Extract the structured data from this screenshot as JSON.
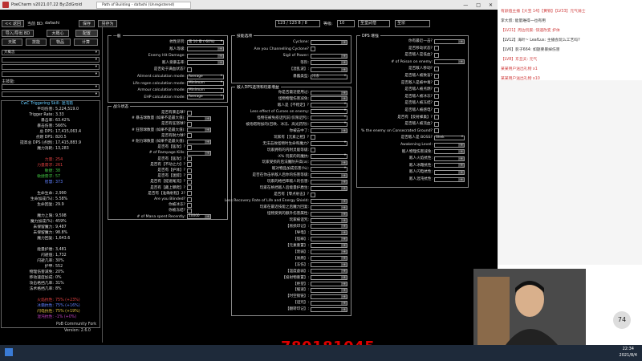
{
  "window": {
    "title": "PoeCharm v2021.07.22 By:ZdGroid",
    "tab": "Path of Building - dafashi (Unregistered)",
    "minimize": "—",
    "maximize": "□",
    "close": "✕"
  },
  "toolbar": {
    "back": "<< 返回",
    "current_bd_label": "当前 BD:",
    "current_bd": "dafashi",
    "save": "保存",
    "save_as": "另存为",
    "points": "123 / 123",
    "points_extra": "8 / 8",
    "level_label": "等级:",
    "level": "10",
    "class": "圣堂武僧",
    "ascendancy": "圣宗",
    "import_export": "导入/导出 BD",
    "notes": "大概心",
    "config": "配置",
    "tab_tree": "天赋",
    "tab_skills": "技能",
    "tab_items": "物品",
    "tab_calcs": "计算"
  },
  "sidebar": {
    "main_skill_label": "主技能:",
    "dropdowns": [
      "大概念",
      "",
      "",
      "",
      "",
      "",
      "",
      "",
      "",
      "",
      ""
    ],
    "stats_header": "CwC Triggering Skill: 混沌箭",
    "stats": [
      {
        "k": "平均伤害:",
        "v": "5,224,519.0",
        "c": "#ddd"
      },
      {
        "k": "Trigger Rate:",
        "v": "3.33",
        "c": "#ddd"
      },
      {
        "k": "暴击率:",
        "v": "63.42%",
        "c": "#ddd"
      },
      {
        "k": "暴击伤害:",
        "v": "566%",
        "c": "#ddd"
      },
      {
        "k": "总 DPS:",
        "v": "17,415,063.4",
        "c": "#ddd"
      },
      {
        "k": "点燃 DPS:",
        "v": "820.5",
        "c": "#ddd"
      },
      {
        "k": "提高总 DPS (点燃):",
        "v": "17,415,883.9",
        "c": "#ddd"
      },
      {
        "k": "魔力消耗:",
        "v": "13,283",
        "c": "#ddd"
      },
      {
        "k": "",
        "v": "",
        "c": "#ddd"
      },
      {
        "k": "力量:",
        "v": "254",
        "c": "#e04040"
      },
      {
        "k": "力量需求:",
        "v": "261",
        "c": "#e04040"
      },
      {
        "k": "敏捷:",
        "v": "38",
        "c": "#40c040"
      },
      {
        "k": "敏捷需求:",
        "v": "57",
        "c": "#40c040"
      },
      {
        "k": "智慧:",
        "v": "373",
        "c": "#6080ff"
      },
      {
        "k": "",
        "v": "",
        "c": "#ddd"
      },
      {
        "k": "生命生命:",
        "v": "2,990",
        "c": "#ddd"
      },
      {
        "k": "生命加成(%):",
        "v": "5.58%",
        "c": "#ddd"
      },
      {
        "k": "生命回复:",
        "v": "29.9",
        "c": "#ddd"
      },
      {
        "k": "",
        "v": "",
        "c": "#ddd"
      },
      {
        "k": "魔力上限:",
        "v": "9,598",
        "c": "#ddd"
      },
      {
        "k": "魔力加成(%):",
        "v": "459%",
        "c": "#ddd"
      },
      {
        "k": "未保留魔力:",
        "v": "9,487",
        "c": "#ddd"
      },
      {
        "k": "未保留魔力:",
        "v": "98.8%",
        "c": "#ddd"
      },
      {
        "k": "魔力回复:",
        "v": "1,643.6",
        "c": "#ddd"
      },
      {
        "k": "",
        "v": "",
        "c": "#ddd"
      },
      {
        "k": "能量护盾:",
        "v": "3,481",
        "c": "#ddd"
      },
      {
        "k": "闪避值:",
        "v": "1,732",
        "c": "#ddd"
      },
      {
        "k": "闪避几率:",
        "v": "30%",
        "c": "#ddd"
      },
      {
        "k": "护甲:",
        "v": "552",
        "c": "#ddd"
      },
      {
        "k": "物理伤害减免:",
        "v": "20%",
        "c": "#ddd"
      },
      {
        "k": "移动速度加成:",
        "v": "0%",
        "c": "#ddd"
      },
      {
        "k": "攻击格挡几率:",
        "v": "31%",
        "c": "#ddd"
      },
      {
        "k": "法术格挡几率:",
        "v": "8%",
        "c": "#ddd"
      },
      {
        "k": "",
        "v": "",
        "c": "#ddd"
      },
      {
        "k": "火焰抗性:",
        "v": "75% (+23%)",
        "c": "#e04040"
      },
      {
        "k": "冰霜抗性:",
        "v": "75% (+16%)",
        "c": "#6080ff"
      },
      {
        "k": "闪电抗性:",
        "v": "75% (+19%)",
        "c": "#e0c040"
      },
      {
        "k": "混沌抗性:",
        "v": "-1% (+0%)",
        "c": "#c040c0"
      }
    ],
    "pob_name": "PoB Community Fork",
    "pob_version": "Version: 2.6.0"
  },
  "general": {
    "title": "一般",
    "rows": [
      {
        "k": "抗性惩罚:",
        "v": "第 10 章 (-60%)"
      },
      {
        "k": "敌人等级:",
        "v": ""
      },
      {
        "k": "Enemy Hit Damage:",
        "v": ""
      },
      {
        "k": "敌人受暴击率:",
        "v": ""
      },
      {
        "k": "是否处于满血状态?",
        "v": ""
      },
      {
        "k": "Ailment calculation mode:",
        "v": "Average"
      },
      {
        "k": "Life regen calculation mode:",
        "v": "Minimum"
      },
      {
        "k": "Armour calculation mode:",
        "v": "Minimum"
      },
      {
        "k": "EHP calculation mode:",
        "v": "Average"
      }
    ]
  },
  "skill_options": {
    "title": "技能选项",
    "rows": [
      {
        "k": "Cyclone:",
        "v": ""
      },
      {
        "k": "Are you Channelling Cyclone?",
        "v": ""
      },
      {
        "k": "Sigil of Power:",
        "v": ""
      },
      {
        "k": "等阶:",
        "v": ""
      },
      {
        "k": "【混乱波】:",
        "v": ""
      },
      {
        "k": "暴露类型:",
        "v": "冷冻"
      }
    ]
  },
  "combat": {
    "title": "战斗状态",
    "rows": [
      {
        "k": "是否有暴击球?",
        "v": ""
      },
      {
        "k": "# 暴击球数量 (如果不是最大值):",
        "v": ""
      },
      {
        "k": "是否有狂怒球?",
        "v": ""
      },
      {
        "k": "# 狂怒球数量 (如果不是最大值):",
        "v": ""
      },
      {
        "k": "是否有耐力球?",
        "v": ""
      },
      {
        "k": "# 耐力球数量 (如果不是最大值):",
        "v": ""
      },
      {
        "k": "是否有【猛攻】?",
        "v": ""
      },
      {
        "k": "# of Rampage Kills:",
        "v": ""
      },
      {
        "k": "是否有【猛攻】?",
        "v": ""
      },
      {
        "k": "是否有【不动之力】?",
        "v": ""
      },
      {
        "k": "是否有【护体】?",
        "v": ""
      },
      {
        "k": "是否有【迷醉】?",
        "v": ""
      },
      {
        "k": "是否有【提速尾流】?",
        "v": ""
      },
      {
        "k": "是否有【藏上攀爬】?",
        "v": ""
      },
      {
        "k": "是否有【准确射程】2?",
        "v": ""
      },
      {
        "k": "Are you Blinded?",
        "v": ""
      },
      {
        "k": "你被冰冻?",
        "v": ""
      },
      {
        "k": "你被冻结?",
        "v": ""
      },
      {
        "k": "# of Mana spent Recently:",
        "v": "10000"
      }
    ]
  },
  "effective_dps": {
    "title": "敌人DPS选项和玩家增益",
    "rows": [
      {
        "k": "你是否最近使用过:",
        "v": ""
      },
      {
        "k": "怪物物理伤害减免:",
        "v": ""
      },
      {
        "k": "敌人是【不稳定】?",
        "v": ""
      },
      {
        "k": "Less effect of Curses on enemy:",
        "v": ""
      },
      {
        "k": "怪物在被免疫诅咒前(仅限诅咒):",
        "v": ""
      },
      {
        "k": "被炮塔附加的(召唤、冰冻、高光药剂):",
        "v": ""
      },
      {
        "k": "你被击中了:",
        "v": ""
      },
      {
        "k": "玩家有【元素之相】?",
        "v": ""
      },
      {
        "k": "无法击败怪物时生命和魔力?",
        "v": ""
      },
      {
        "k": "玩家拥有的内附灵能等级:",
        "v": ""
      },
      {
        "k": "-X% 玩家的的魔抗:",
        "v": ""
      },
      {
        "k": "玩家受损的后法魔防升高(a):",
        "v": ""
      },
      {
        "k": "敌对物品加成伤害(%):",
        "v": ""
      },
      {
        "k": "是否在你击杀敌人后你的伤害等级:",
        "v": ""
      },
      {
        "k": "玩家的格挡率敌人的伤害:",
        "v": ""
      },
      {
        "k": "玩家在格挡敌人后能量护盾生:",
        "v": ""
      },
      {
        "k": "是否有【零点射击】?",
        "v": ""
      },
      {
        "k": "Less Recovery Rate of Life and Energy Shield:",
        "v": ""
      },
      {
        "k": "玩家在最近技能之后魔力回复:",
        "v": ""
      },
      {
        "k": "怪物受到的额外伤害属性:",
        "v": ""
      },
      {
        "k": "玩家被诅咒:",
        "v": ""
      },
      {
        "k": "【易损印记】:",
        "v": ""
      },
      {
        "k": "【导电】:",
        "v": ""
      },
      {
        "k": "【怪罪】:",
        "v": ""
      },
      {
        "k": "【元素重置】:",
        "v": ""
      },
      {
        "k": "【衰弱】:",
        "v": ""
      },
      {
        "k": "【易燃】:",
        "v": ""
      },
      {
        "k": "【冻伤】:",
        "v": ""
      },
      {
        "k": "【温度虚弱】:",
        "v": ""
      },
      {
        "k": "【投射物重置】:",
        "v": ""
      },
      {
        "k": "【绝望】:",
        "v": ""
      },
      {
        "k": "【缓速】:",
        "v": ""
      },
      {
        "k": "【时空锁链】:",
        "v": ""
      },
      {
        "k": "【诅咒】:",
        "v": ""
      },
      {
        "k": "【翻转印记】:",
        "v": ""
      }
    ]
  },
  "dps_options": {
    "title": "DPS 增强",
    "rows": [
      {
        "k": "你有最近一击?",
        "v": ""
      },
      {
        "k": "是否移动状态?",
        "v": ""
      },
      {
        "k": "是否敌人是低血?",
        "v": ""
      },
      {
        "k": "# of Poison on enemy:",
        "v": ""
      },
      {
        "k": "是否敌人移动?",
        "v": ""
      },
      {
        "k": "是否敌人被致盲?",
        "v": ""
      },
      {
        "k": "是否敌人是被中毒?",
        "v": ""
      },
      {
        "k": "是否敌人被点燃?",
        "v": ""
      },
      {
        "k": "是否敌人被冰冻?",
        "v": ""
      },
      {
        "k": "是否敌人被冻结?",
        "v": ""
      },
      {
        "k": "是否敌人被感电?",
        "v": ""
      },
      {
        "k": "是否有【反射蜂巢】?",
        "v": ""
      },
      {
        "k": "是否敌人被流血?",
        "v": ""
      },
      {
        "k": "% the enemy on Consecrated Ground?",
        "v": ""
      },
      {
        "k": "是否敌人是 BOSS?",
        "v": "Shek"
      },
      {
        "k": "Awakening Level:",
        "v": ""
      },
      {
        "k": "敌人物理伤害减免:",
        "v": ""
      },
      {
        "k": "敌人火焰抗性:",
        "v": ""
      },
      {
        "k": "敌人冰霜抗性:",
        "v": ""
      },
      {
        "k": "敌人闪电抗性:",
        "v": ""
      },
      {
        "k": "敌人混沌抗性:",
        "v": ""
      }
    ]
  },
  "chat": {
    "lines": [
      {
        "text": "有颜值主播【大宝 14】【黄铁】【LV33】元气骑士",
        "c": "#d04040"
      },
      {
        "text": "李大叔: 能量难得一也有用",
        "c": "#333"
      },
      {
        "text": "【LV21】周边玩家: 快速改变 护体",
        "c": "#d04040"
      },
      {
        "text": "【LV12】海叶~ LeafLus: 主播会玩么工艺吗?",
        "c": "#333"
      },
      {
        "text": "【LV6】影子664: 如题要暴掉伤害",
        "c": "#333"
      },
      {
        "text": "【LV8】东旦夭: 元气",
        "c": "#d04040"
      },
      {
        "text": "某某用户送出礼物 x1",
        "c": "#d04040"
      },
      {
        "text": "某某用户送出礼物 x10",
        "c": "#d04040"
      }
    ]
  },
  "overlay": {
    "number": "780181045"
  },
  "taskbar": {
    "time": "22:34",
    "date": "2021/8/4",
    "score": "74"
  },
  "colors": {
    "accent_red": "#d00",
    "panel_border": "#888"
  }
}
